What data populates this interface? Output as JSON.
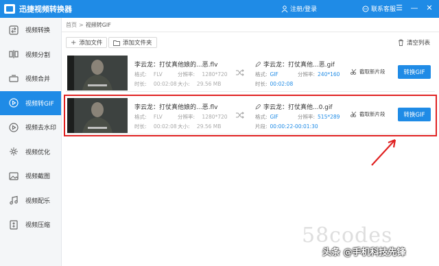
{
  "app": {
    "title": "迅捷视频转换器"
  },
  "header": {
    "login": "注册/登录",
    "service": "联系客服",
    "window_controls": [
      "☰",
      "—",
      "✕"
    ]
  },
  "sidebar": {
    "items": [
      {
        "label": "视频转换",
        "icon": "video-convert-icon",
        "active": false
      },
      {
        "label": "视频分割",
        "icon": "video-split-icon",
        "active": false
      },
      {
        "label": "视频合并",
        "icon": "video-merge-icon",
        "active": false
      },
      {
        "label": "视频转GIF",
        "icon": "gif-play-icon",
        "active": true
      },
      {
        "label": "视频去水印",
        "icon": "watermark-remove-icon",
        "active": false
      },
      {
        "label": "视频优化",
        "icon": "optimize-icon",
        "active": false
      },
      {
        "label": "视频截图",
        "icon": "screenshot-icon",
        "active": false
      },
      {
        "label": "视频配乐",
        "icon": "music-icon",
        "active": false
      },
      {
        "label": "视频压缩",
        "icon": "compress-icon",
        "active": false
      }
    ]
  },
  "breadcrumb": {
    "home": "首页",
    "sep": ">",
    "current": "视频转GIF"
  },
  "toolbar": {
    "add_file": "添加文件",
    "add_folder": "添加文件夹",
    "clear_list": "清空列表"
  },
  "rows": [
    {
      "src_title": "李云龙：打仗真他娘的...恶.flv",
      "format_label": "格式:",
      "format": "FLV",
      "res_label": "分辨率:",
      "res": "1280*720",
      "dur_label": "时长:",
      "dur": "00:02:08",
      "size_label": "大小:",
      "size": "29.56 MB",
      "dst_title": "李云龙：打仗真他...恶.gif",
      "dformat_label": "格式:",
      "dformat": "GIF",
      "dres_label": "分辨率:",
      "dres": "240*160",
      "ddur_label": "时长:",
      "ddur": "00:02:08",
      "clip": "截取新片段",
      "convert": "转换GIF"
    },
    {
      "src_title": "李云龙：打仗真他娘的...恶.flv",
      "format_label": "格式:",
      "format": "FLV",
      "res_label": "分辨率:",
      "res": "1280*720",
      "dur_label": "时长:",
      "dur": "00:02:08",
      "size_label": "大小:",
      "size": "29.56 MB",
      "dst_title": "李云龙：打仗真他...0.gif",
      "dformat_label": "格式:",
      "dformat": "GIF",
      "dres_label": "分辨率:",
      "dres": "515*289",
      "ddur_label": "片段:",
      "ddur": "00:00:22-00:01:30",
      "clip": "截取新片段",
      "convert": "转换GIF"
    }
  ],
  "watermark": {
    "site": "58codes",
    "credit": "头条 @手机科技先锋"
  },
  "colors": {
    "accent": "#1f8be6",
    "highlight": "#e02020"
  }
}
